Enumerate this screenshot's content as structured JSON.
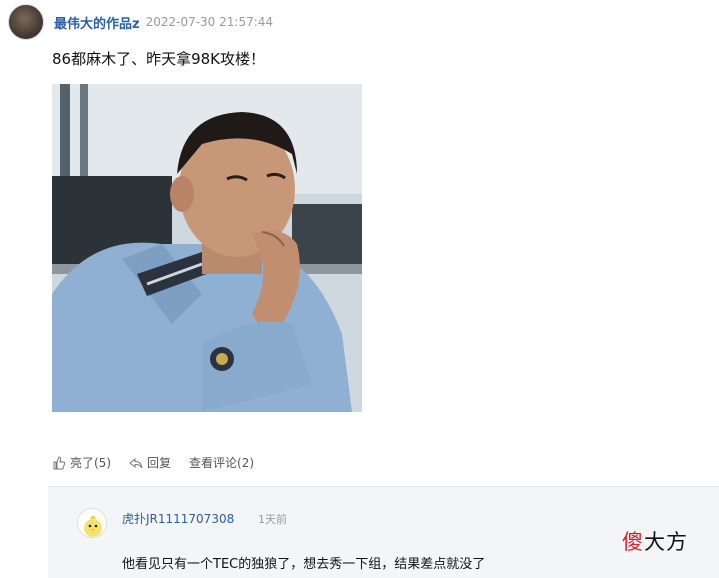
{
  "post": {
    "author": "最伟大的作品z",
    "timestamp": "2022-07-30 21:57:44",
    "text": "86都麻木了、昨天拿98K攻楼！"
  },
  "actions": {
    "like_label": "亮了(5)",
    "reply_label": "回复",
    "view_comments_label": "查看评论(2)"
  },
  "comment": {
    "user": "虎扑JR1111707308",
    "time": "1天前",
    "text": "他看见只有一个TEC的独狼了，想去秀一下组，结果差点就没了"
  },
  "watermark": {
    "char1": "傻",
    "rest": "大方"
  },
  "colors": {
    "link_blue": "#2a5fa8",
    "comment_bg": "#f4f5f7",
    "watermark_red": "#d8202a"
  }
}
